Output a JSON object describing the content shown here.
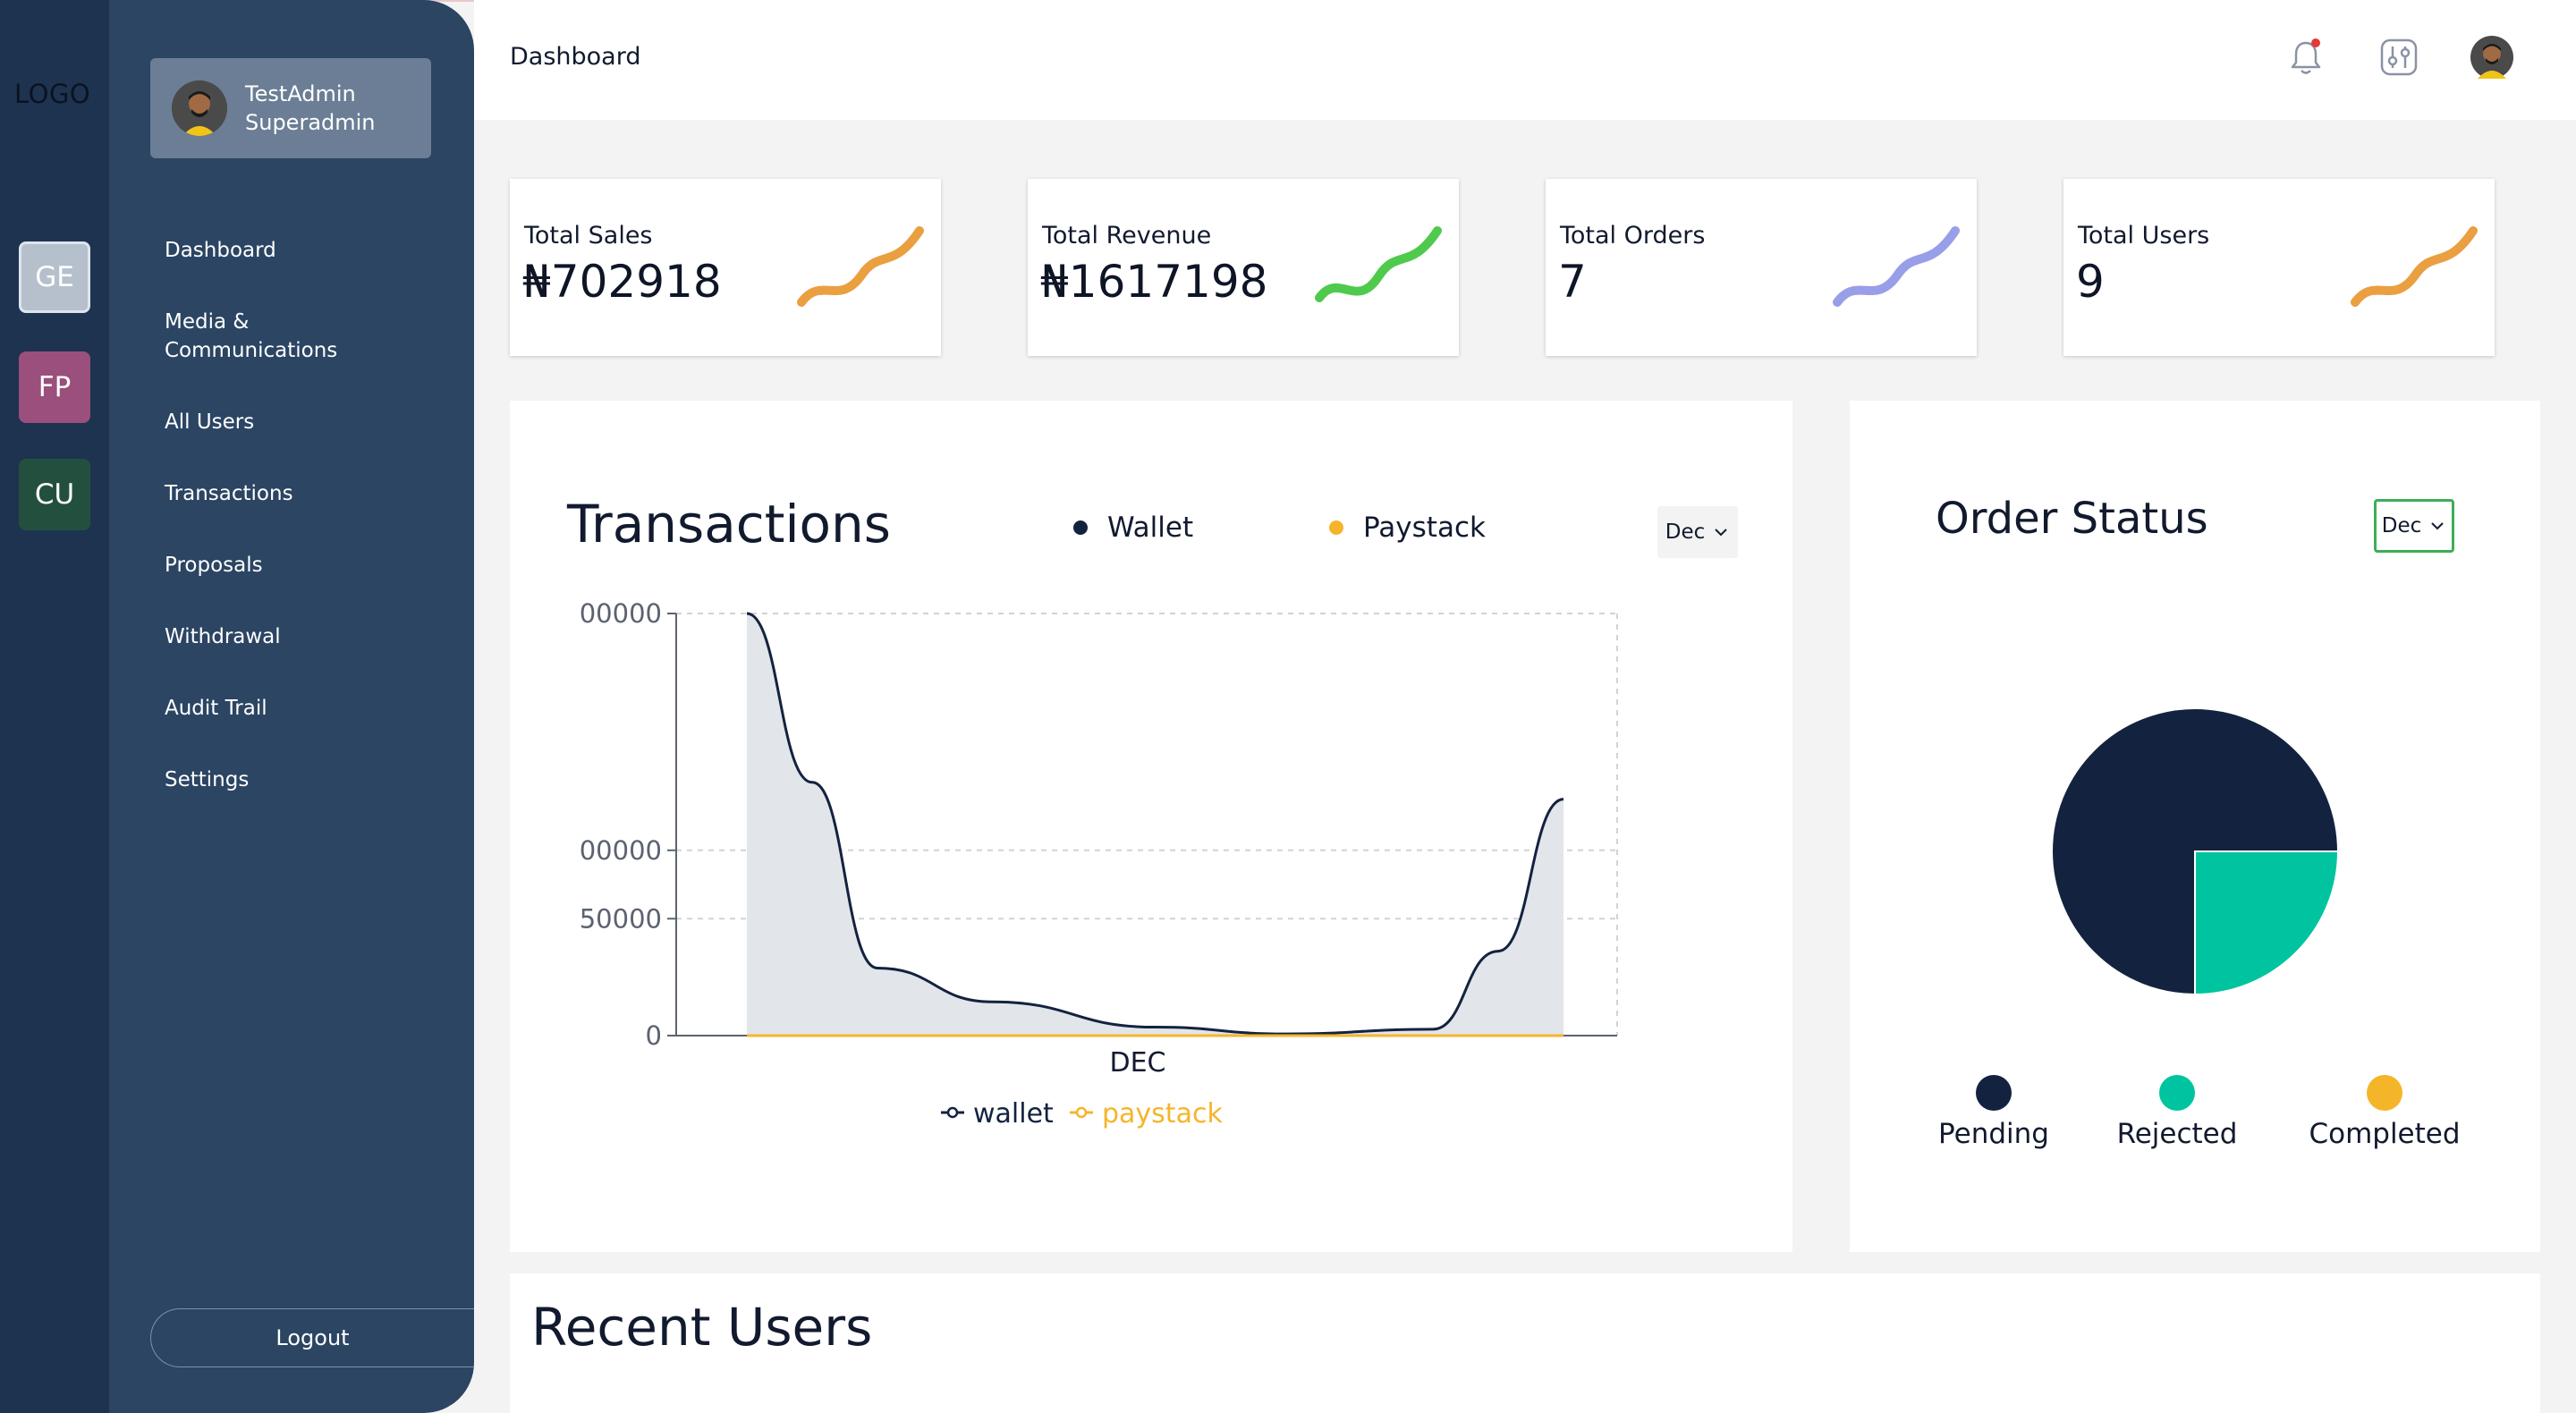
{
  "rail": {
    "logo": "LOGO",
    "workspaces": [
      {
        "label": "GE",
        "color": "#b6c0cc"
      },
      {
        "label": "FP",
        "color": "#9a4f7c"
      },
      {
        "label": "CU",
        "color": "#23503e"
      }
    ]
  },
  "sidebar": {
    "user": {
      "name": "TestAdmin",
      "role": "Superadmin"
    },
    "items": [
      {
        "label": "Dashboard"
      },
      {
        "label": "Media &"
      },
      {
        "label": "Communications"
      },
      {
        "label": "All Users"
      },
      {
        "label": "Transactions"
      },
      {
        "label": "Proposals"
      },
      {
        "label": "Withdrawal"
      },
      {
        "label": "Audit Trail"
      },
      {
        "label": "Settings"
      }
    ],
    "logout": "Logout"
  },
  "header": {
    "title": "Dashboard",
    "icons": [
      "bell-icon",
      "settings-sliders-icon",
      "user-avatar-icon"
    ]
  },
  "stats": [
    {
      "label": "Total Sales",
      "value": "₦702918",
      "spark_color": "#e8952c"
    },
    {
      "label": "Total Revenue",
      "value": "₦1617198",
      "spark_color": "#3cc43a"
    },
    {
      "label": "Total Orders",
      "value": "7",
      "spark_color": "#8d93e6"
    },
    {
      "label": "Total Users",
      "value": "9",
      "spark_color": "#e8952c"
    }
  ],
  "transactions": {
    "title": "Transactions",
    "legend": [
      {
        "label": "Wallet",
        "color": "#13223f"
      },
      {
        "label": "Paystack",
        "color": "#f5b52a"
      }
    ],
    "month": "Dec",
    "chart_data": {
      "type": "area",
      "categories": [
        "DEC"
      ],
      "y_ticks": [
        "0",
        "50000",
        "00000",
        "00000"
      ],
      "series": [
        {
          "name": "wallet",
          "color": "#13223f",
          "x": [
            0,
            0.08,
            0.16,
            0.3,
            0.5,
            0.66,
            0.84,
            0.92,
            1.0
          ],
          "values": [
            1000000,
            600000,
            160000,
            80000,
            20000,
            4000,
            15000,
            200000,
            560000
          ]
        },
        {
          "name": "paystack",
          "color": "#f5b52a",
          "x": [
            0,
            1.0
          ],
          "values": [
            0,
            0
          ]
        }
      ],
      "xlabel": "DEC",
      "ylim": [
        0,
        1000000
      ],
      "grid": true,
      "legend_position": "bottom"
    }
  },
  "order_status": {
    "title": "Order Status",
    "month": "Dec",
    "chart_data": {
      "type": "pie",
      "labels": [
        "Pending",
        "Rejected",
        "Completed"
      ],
      "values": [
        75,
        25,
        0
      ],
      "colors": [
        "#13223f",
        "#00c49f",
        "#f5b52a"
      ],
      "legend_position": "bottom"
    }
  },
  "recent_users": {
    "title": "Recent Users"
  }
}
